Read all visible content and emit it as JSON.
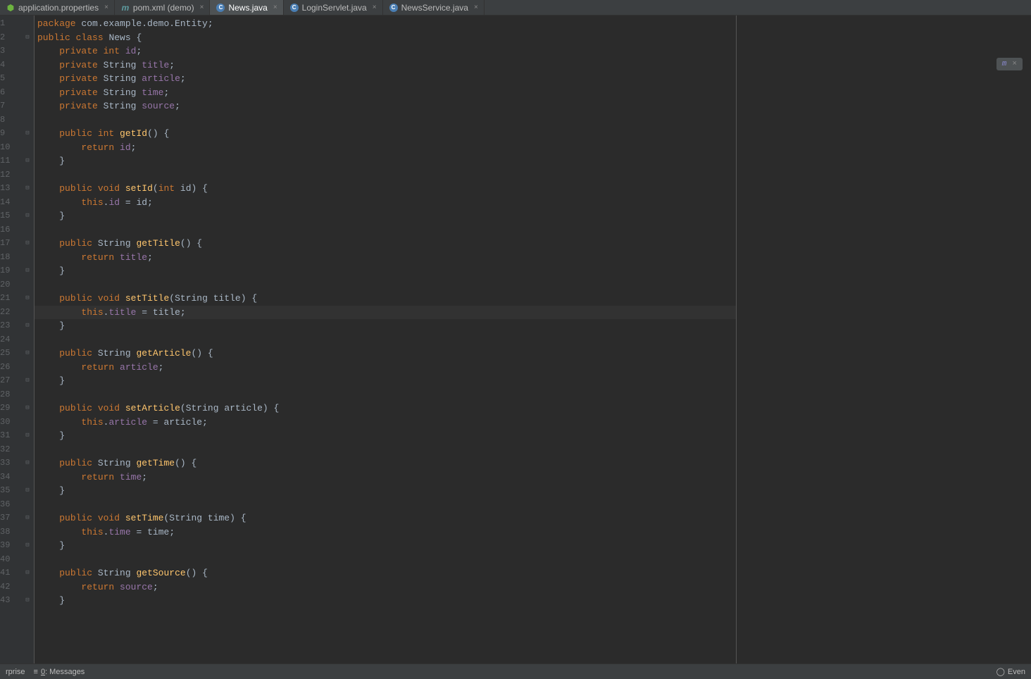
{
  "tabs": [
    {
      "icon": "spring",
      "label": "application.properties",
      "active": false
    },
    {
      "icon": "maven",
      "label": "pom.xml (demo)",
      "active": false
    },
    {
      "icon": "java",
      "label": "News.java",
      "active": true
    },
    {
      "icon": "java",
      "label": "LoginServlet.java",
      "active": false
    },
    {
      "icon": "java",
      "label": "NewsService.java",
      "active": false
    }
  ],
  "minimap_badge": "m",
  "code_lines": [
    {
      "n": 1,
      "fold": "",
      "html": "<span class='kw'>package</span> <span class='pkg'>com.example.demo.Entity</span><span class='punct'>;</span>"
    },
    {
      "n": 2,
      "fold": "⊟",
      "html": "<span class='kw'>public class</span> <span class='type'>News</span> <span class='punct'>{</span>"
    },
    {
      "n": 3,
      "fold": "",
      "html": "    <span class='kw'>private int</span> <span class='field'>id</span><span class='punct'>;</span>"
    },
    {
      "n": 4,
      "fold": "",
      "html": "    <span class='kw'>private</span> <span class='type'>String</span> <span class='field'>title</span><span class='punct'>;</span>"
    },
    {
      "n": 5,
      "fold": "",
      "html": "    <span class='kw'>private</span> <span class='type'>String</span> <span class='field'>article</span><span class='punct'>;</span>"
    },
    {
      "n": 6,
      "fold": "",
      "html": "    <span class='kw'>private</span> <span class='type'>String</span> <span class='field'>time</span><span class='punct'>;</span>"
    },
    {
      "n": 7,
      "fold": "",
      "html": "    <span class='kw'>private</span> <span class='type'>String</span> <span class='field'>source</span><span class='punct'>;</span>"
    },
    {
      "n": 8,
      "fold": "",
      "html": ""
    },
    {
      "n": 9,
      "fold": "⊟",
      "html": "    <span class='kw'>public int</span> <span class='method'>getId</span><span class='punct'>() {</span>"
    },
    {
      "n": 10,
      "fold": "",
      "html": "        <span class='kw'>return</span> <span class='field'>id</span><span class='punct'>;</span>"
    },
    {
      "n": 11,
      "fold": "⊟",
      "html": "    <span class='punct'>}</span>"
    },
    {
      "n": 12,
      "fold": "",
      "html": ""
    },
    {
      "n": 13,
      "fold": "⊟",
      "html": "    <span class='kw'>public void</span> <span class='method'>setId</span><span class='punct'>(</span><span class='kw'>int</span> <span class='param'>id</span><span class='punct'>) {</span>"
    },
    {
      "n": 14,
      "fold": "",
      "html": "        <span class='kw'>this</span><span class='punct'>.</span><span class='field'>id</span> <span class='punct'>=</span> <span class='param'>id</span><span class='punct'>;</span>"
    },
    {
      "n": 15,
      "fold": "⊟",
      "html": "    <span class='punct'>}</span>"
    },
    {
      "n": 16,
      "fold": "",
      "html": ""
    },
    {
      "n": 17,
      "fold": "⊟",
      "html": "    <span class='kw'>public</span> <span class='type'>String</span> <span class='method'>getTitle</span><span class='punct'>() {</span>"
    },
    {
      "n": 18,
      "fold": "",
      "html": "        <span class='kw'>return</span> <span class='field'>title</span><span class='punct'>;</span>"
    },
    {
      "n": 19,
      "fold": "⊟",
      "html": "    <span class='punct'>}</span>"
    },
    {
      "n": 20,
      "fold": "",
      "html": ""
    },
    {
      "n": 21,
      "fold": "⊟",
      "html": "    <span class='kw'>public void</span> <span class='method'>setTitle</span><span class='punct'>(</span><span class='type'>String</span> <span class='param'>title</span><span class='punct'>) {</span>"
    },
    {
      "n": 22,
      "fold": "",
      "html": "        <span class='kw'>this</span><span class='punct'>.</span><span class='field'>title</span> <span class='punct'>=</span> <span class='param'>title</span><span class='punct'>;</span>",
      "highlighted": true
    },
    {
      "n": 23,
      "fold": "⊟",
      "html": "    <span class='punct'>}</span>"
    },
    {
      "n": 24,
      "fold": "",
      "html": ""
    },
    {
      "n": 25,
      "fold": "⊟",
      "html": "    <span class='kw'>public</span> <span class='type'>String</span> <span class='method'>getArticle</span><span class='punct'>() {</span>"
    },
    {
      "n": 26,
      "fold": "",
      "html": "        <span class='kw'>return</span> <span class='field'>article</span><span class='punct'>;</span>"
    },
    {
      "n": 27,
      "fold": "⊟",
      "html": "    <span class='punct'>}</span>"
    },
    {
      "n": 28,
      "fold": "",
      "html": ""
    },
    {
      "n": 29,
      "fold": "⊟",
      "html": "    <span class='kw'>public void</span> <span class='method'>setArticle</span><span class='punct'>(</span><span class='type'>String</span> <span class='param'>article</span><span class='punct'>) {</span>"
    },
    {
      "n": 30,
      "fold": "",
      "html": "        <span class='kw'>this</span><span class='punct'>.</span><span class='field'>article</span> <span class='punct'>=</span> <span class='param'>article</span><span class='punct'>;</span>"
    },
    {
      "n": 31,
      "fold": "⊟",
      "html": "    <span class='punct'>}</span>"
    },
    {
      "n": 32,
      "fold": "",
      "html": ""
    },
    {
      "n": 33,
      "fold": "⊟",
      "html": "    <span class='kw'>public</span> <span class='type'>String</span> <span class='method'>getTime</span><span class='punct'>() {</span>"
    },
    {
      "n": 34,
      "fold": "",
      "html": "        <span class='kw'>return</span> <span class='field'>time</span><span class='punct'>;</span>"
    },
    {
      "n": 35,
      "fold": "⊟",
      "html": "    <span class='punct'>}</span>"
    },
    {
      "n": 36,
      "fold": "",
      "html": ""
    },
    {
      "n": 37,
      "fold": "⊟",
      "html": "    <span class='kw'>public void</span> <span class='method'>setTime</span><span class='punct'>(</span><span class='type'>String</span> <span class='param'>time</span><span class='punct'>) {</span>"
    },
    {
      "n": 38,
      "fold": "",
      "html": "        <span class='kw'>this</span><span class='punct'>.</span><span class='field'>time</span> <span class='punct'>=</span> <span class='param'>time</span><span class='punct'>;</span>"
    },
    {
      "n": 39,
      "fold": "⊟",
      "html": "    <span class='punct'>}</span>"
    },
    {
      "n": 40,
      "fold": "",
      "html": ""
    },
    {
      "n": 41,
      "fold": "⊟",
      "html": "    <span class='kw'>public</span> <span class='type'>String</span> <span class='method'>getSource</span><span class='punct'>() {</span>"
    },
    {
      "n": 42,
      "fold": "",
      "html": "        <span class='kw'>return</span> <span class='field'>source</span><span class='punct'>;</span>"
    },
    {
      "n": 43,
      "fold": "⊟",
      "html": "    <span class='punct'>}</span>"
    }
  ],
  "status": {
    "left_item_1": "rprise",
    "messages_label": "0: Messages",
    "messages_underline": "0",
    "right_item": "Even"
  }
}
